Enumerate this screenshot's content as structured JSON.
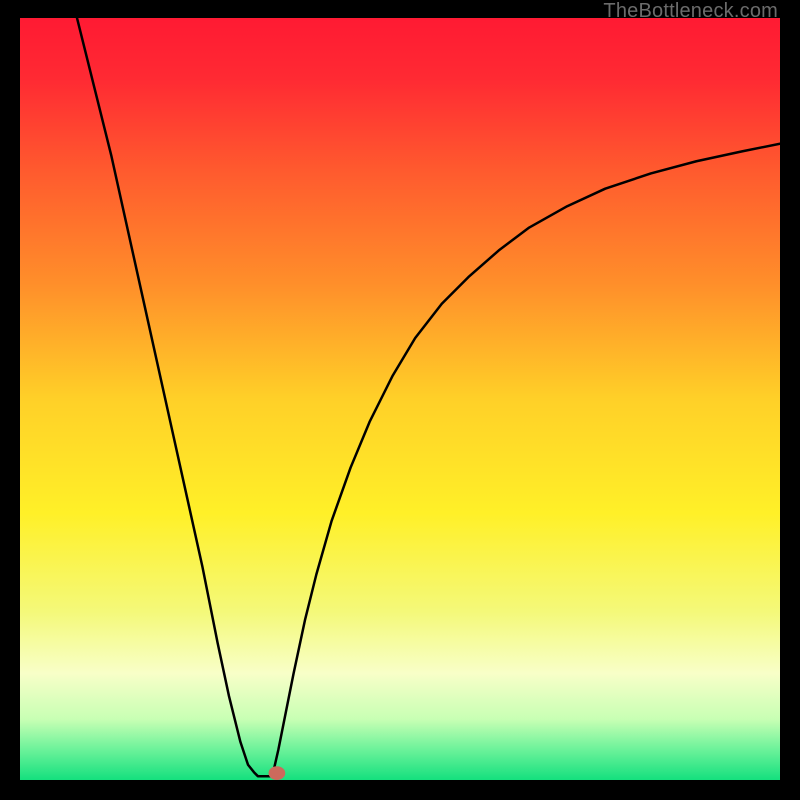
{
  "watermark": "TheBottleneck.com",
  "chart_data": {
    "type": "line",
    "title": "",
    "xlabel": "",
    "ylabel": "",
    "xlim": [
      0,
      100
    ],
    "ylim": [
      0,
      100
    ],
    "grid": false,
    "background_gradient": {
      "stops": [
        {
          "pos": 0.0,
          "color": "#ff1a33"
        },
        {
          "pos": 0.08,
          "color": "#ff2a33"
        },
        {
          "pos": 0.2,
          "color": "#ff5a2e"
        },
        {
          "pos": 0.35,
          "color": "#ff8f2a"
        },
        {
          "pos": 0.5,
          "color": "#ffd028"
        },
        {
          "pos": 0.65,
          "color": "#fff028"
        },
        {
          "pos": 0.78,
          "color": "#f4f97a"
        },
        {
          "pos": 0.86,
          "color": "#f8ffc8"
        },
        {
          "pos": 0.92,
          "color": "#c8ffb4"
        },
        {
          "pos": 0.96,
          "color": "#6cf29a"
        },
        {
          "pos": 1.0,
          "color": "#14e07e"
        }
      ]
    },
    "series": [
      {
        "name": "left-branch",
        "x": [
          7.5,
          10,
          12,
          14,
          16,
          18,
          20,
          22,
          24,
          26,
          27.5,
          29,
          30,
          30.8,
          31.3
        ],
        "y": [
          100,
          90,
          82,
          73,
          64,
          55,
          46,
          37,
          28,
          18,
          11,
          5,
          2,
          1,
          0.5
        ]
      },
      {
        "name": "valley-flat",
        "x": [
          31.3,
          33.2
        ],
        "y": [
          0.5,
          0.5
        ]
      },
      {
        "name": "right-branch",
        "x": [
          33.2,
          34,
          35,
          36,
          37.5,
          39,
          41,
          43.5,
          46,
          49,
          52,
          55.5,
          59,
          63,
          67,
          72,
          77,
          83,
          89,
          95,
          100
        ],
        "y": [
          0.5,
          4,
          9,
          14,
          21,
          27,
          34,
          41,
          47,
          53,
          58,
          62.5,
          66,
          69.5,
          72.5,
          75.3,
          77.6,
          79.6,
          81.2,
          82.5,
          83.5
        ]
      }
    ],
    "marker": {
      "name": "valley-marker",
      "x": 33.8,
      "y": 0.9,
      "rx": 1.1,
      "ry": 0.9,
      "color": "#cc6a5c"
    }
  }
}
